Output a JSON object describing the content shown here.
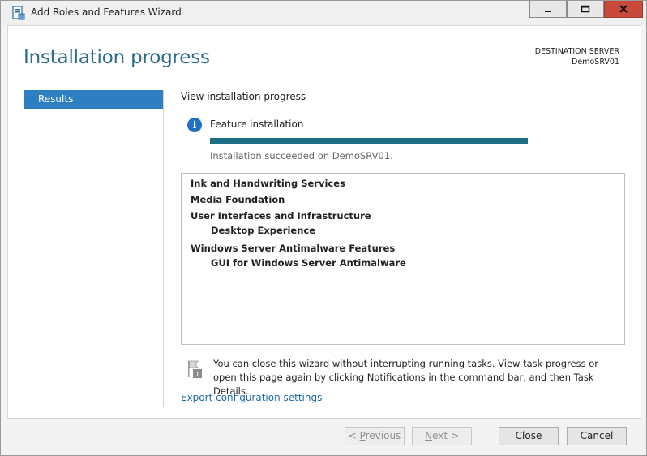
{
  "window": {
    "title": "Add Roles and Features Wizard",
    "controls": {
      "minimize": "minimize",
      "maximize": "maximize",
      "close": "close"
    }
  },
  "header": {
    "page_title": "Installation progress",
    "destination_label": "DESTINATION SERVER",
    "destination_server": "DemoSRV01"
  },
  "nav": {
    "items": [
      {
        "label": "Results",
        "selected": true
      }
    ]
  },
  "main": {
    "view_label": "View installation progress",
    "status_title": "Feature installation",
    "progress": 1.0,
    "status_message": "Installation succeeded on DemoSRV01.",
    "features": [
      {
        "label": "Ink and Handwriting Services",
        "level": 0
      },
      {
        "label": "Media Foundation",
        "level": 0
      },
      {
        "label": "User Interfaces and Infrastructure",
        "level": 0
      },
      {
        "label": "Desktop Experience",
        "level": 1
      },
      {
        "label": "Windows Server Antimalware Features",
        "level": 0
      },
      {
        "label": "GUI for Windows Server Antimalware",
        "level": 1
      }
    ],
    "note": "You can close this wizard without interrupting running tasks. View task progress or open this page again by clicking Notifications in the command bar, and then Task Details.",
    "note_badge": "1",
    "export_link": "Export configuration settings"
  },
  "footer": {
    "previous": {
      "prefix": "< ",
      "mnemonic": "P",
      "rest": "revious",
      "enabled": false
    },
    "next": {
      "mnemonic": "N",
      "rest": "ext >",
      "enabled": false
    },
    "close": "Close",
    "cancel": "Cancel"
  },
  "colors": {
    "title_accent": "#2c6a8c",
    "nav_selected": "#2d7fc2",
    "progress_fill": "#1e6f85",
    "link": "#1a6aa8",
    "close_button": "#c74a3c"
  }
}
